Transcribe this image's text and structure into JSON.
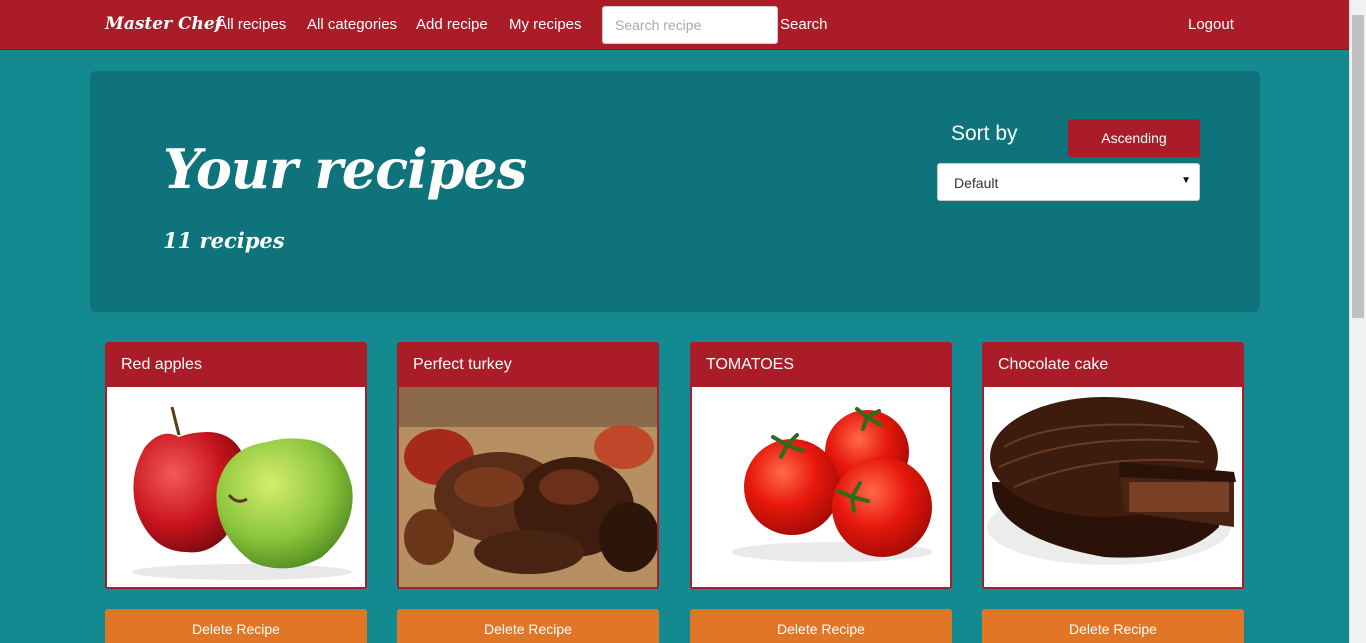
{
  "navbar": {
    "brand": "Master Chef",
    "links": [
      "All recipes",
      "All categories",
      "Add recipe",
      "My recipes"
    ],
    "search": {
      "placeholder": "Search recipe",
      "button": "Search"
    },
    "logout": "Logout"
  },
  "hero": {
    "title": "Your recipes",
    "count": "11 recipes",
    "sort_label": "Sort by",
    "order_button": "Ascending",
    "sort_selected": "Default"
  },
  "recipes": [
    {
      "title": "Red apples",
      "delete": "Delete Recipe"
    },
    {
      "title": "Perfect turkey",
      "delete": "Delete Recipe"
    },
    {
      "title": "TOMATOES",
      "delete": "Delete Recipe"
    },
    {
      "title": "Chocolate cake",
      "delete": "Delete Recipe"
    }
  ],
  "colors": {
    "navbar": "#aa1c27",
    "background": "#128a90",
    "hero": "#0f737b",
    "delete_button": "#e07626"
  }
}
